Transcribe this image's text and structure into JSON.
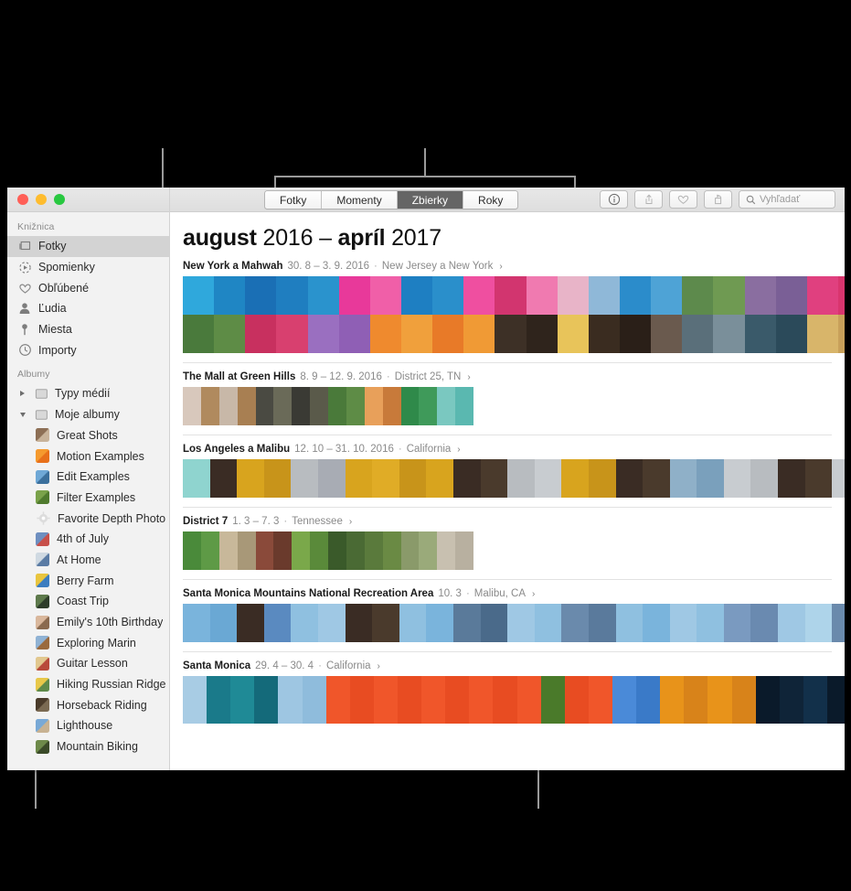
{
  "window": {
    "traffic_lights": [
      "close",
      "minimize",
      "zoom"
    ]
  },
  "sidebar": {
    "library_section": "Knižnica",
    "library_items": [
      {
        "label": "Fotky",
        "icon": "photos-icon",
        "selected": true
      },
      {
        "label": "Spomienky",
        "icon": "memories-icon",
        "selected": false
      },
      {
        "label": "Obľúbené",
        "icon": "heart-icon",
        "selected": false
      },
      {
        "label": "Ľudia",
        "icon": "person-icon",
        "selected": false
      },
      {
        "label": "Miesta",
        "icon": "pin-icon",
        "selected": false
      },
      {
        "label": "Importy",
        "icon": "clock-icon",
        "selected": false
      }
    ],
    "albums_section": "Albumy",
    "groups": [
      {
        "label": "Typy médií",
        "icon": "folder-icon",
        "expanded": false
      },
      {
        "label": "Moje albumy",
        "icon": "folder-icon",
        "expanded": true
      }
    ],
    "albums": [
      {
        "label": "Great Shots",
        "c1": "#8d6f55",
        "c2": "#c8b39a"
      },
      {
        "label": "Motion Examples",
        "c1": "#f59a2e",
        "c2": "#e8701a"
      },
      {
        "label": "Edit Examples",
        "c1": "#6fa8d6",
        "c2": "#3b6f9c"
      },
      {
        "label": "Filter Examples",
        "c1": "#7aa24a",
        "c2": "#4f7a2d"
      },
      {
        "label": "Favorite Depth Photo",
        "c1": "#dcdcdc",
        "c2": "#c4c4c4",
        "icon": "gear-icon"
      },
      {
        "label": "4th of July",
        "c1": "#6e8fc0",
        "c2": "#c7504a"
      },
      {
        "label": "At Home",
        "c1": "#cfd9e2",
        "c2": "#5a7ba4"
      },
      {
        "label": "Berry Farm",
        "c1": "#e9c53e",
        "c2": "#3c7dc0"
      },
      {
        "label": "Coast Trip",
        "c1": "#5e7a4c",
        "c2": "#2e3d2a"
      },
      {
        "label": "Emily's 10th Birthday",
        "c1": "#d9b79c",
        "c2": "#8a6a4f"
      },
      {
        "label": "Exploring Marin",
        "c1": "#8fb2d4",
        "c2": "#9a6a3e"
      },
      {
        "label": "Guitar Lesson",
        "c1": "#e2c88f",
        "c2": "#b84a3a"
      },
      {
        "label": "Hiking Russian Ridge",
        "c1": "#e8c84a",
        "c2": "#5e8a4a"
      },
      {
        "label": "Horseback Riding",
        "c1": "#4a3b2a",
        "c2": "#7a6a52"
      },
      {
        "label": "Lighthouse",
        "c1": "#79a9d6",
        "c2": "#c8b292"
      },
      {
        "label": "Mountain Biking",
        "c1": "#6e8a4a",
        "c2": "#3a4a28"
      }
    ]
  },
  "toolbar": {
    "tabs": [
      {
        "label": "Fotky",
        "selected": false
      },
      {
        "label": "Momenty",
        "selected": false
      },
      {
        "label": "Zbierky",
        "selected": true
      },
      {
        "label": "Roky",
        "selected": false
      }
    ],
    "buttons": [
      {
        "name": "info-icon",
        "glyph": "ⓘ"
      },
      {
        "name": "share-icon",
        "glyph": "⇧"
      },
      {
        "name": "favorite-icon",
        "glyph": "♡"
      },
      {
        "name": "rotate-icon",
        "glyph": "↻"
      }
    ],
    "search_placeholder": "Vyhľadať"
  },
  "content": {
    "title_month_start": "august",
    "title_year_start": "2016",
    "title_dash": "–",
    "title_month_end": "apríl",
    "title_year_end": "2017",
    "collections": [
      {
        "name": "New York a Mahwah",
        "dates": "30. 8 – 3. 9. 2016",
        "separator": "·",
        "place": "New Jersey a New York",
        "chevron": "›",
        "rows": 2,
        "strip_height": 84,
        "photos": [
          "#2fa8dc",
          "#1f86c4",
          "#1a6fb5",
          "#1f7ec0",
          "#2a93cd",
          "#e8399a",
          "#f05fa8",
          "#1e7fc2",
          "#2a8fcb",
          "#ef4fa0",
          "#d2356f",
          "#f07ab0",
          "#e8b4c8",
          "#8fb8d8",
          "#2b8ccb",
          "#4ea3d6",
          "#5d8a4c",
          "#6f9a52",
          "#8a6ea0",
          "#7a5f96",
          "#e0407f",
          "#d9356e",
          "#3a6f52",
          "#2f5f46",
          "#c76a8a",
          "#b85a7a",
          "#4a7a3c",
          "#5e8c46",
          "#c8305f",
          "#d8406f",
          "#9a6fc0",
          "#8f5fb5",
          "#ef8a2e",
          "#f0a03c",
          "#e87a28",
          "#f09a35",
          "#3d3026",
          "#2f241c",
          "#e8c45a",
          "#3a2c20",
          "#2a1f18",
          "#6a5a4e",
          "#5a6f7a",
          "#7a8f9a",
          "#3a5a6a",
          "#2b4a5a",
          "#d8b56a",
          "#c8a05a",
          "#8a3a3a",
          "#aa4a4a",
          "#e8d44a",
          "#4a4a3a"
        ]
      },
      {
        "name": "The Mall at Green Hills",
        "dates": "8. 9 – 12. 9. 2016",
        "separator": "·",
        "place": "District 25, TN",
        "chevron": "›",
        "rows": 1,
        "strip_height": 42,
        "photos": [
          "#d8c8bc",
          "#b08a5e",
          "#c8b8a8",
          "#a87f52",
          "#4a4a42",
          "#6a6a58",
          "#3a3a34",
          "#5a5a4a",
          "#4a7a3a",
          "#5e8c46",
          "#e8a05a",
          "#c87a3a",
          "#2f8a4a",
          "#3f9a5a",
          "#7ac8c0",
          "#5ab8b0"
        ]
      },
      {
        "name": "Los Angeles a Malibu",
        "dates": "12. 10 – 31. 10. 2016",
        "separator": "·",
        "place": "California",
        "chevron": "›",
        "rows": 1,
        "strip_height": 42,
        "photos": [
          "#8fd4cf",
          "#3a2c24",
          "#d8a41e",
          "#c8941a",
          "#b8bcc0",
          "#a8acb4",
          "#d8a41e",
          "#e0ac26",
          "#c8941a",
          "#d8a41e",
          "#3a2c24",
          "#4a3a2c",
          "#b8bcc0",
          "#c8ccd0",
          "#d8a41e",
          "#c8941a",
          "#3a2c24",
          "#4a3a2c",
          "#8fb0c8",
          "#7aa0bc",
          "#c8ccd0",
          "#b8bcc0",
          "#3a2c24",
          "#4a3a2c",
          "#c8ccd0",
          "#e8c49a",
          "#d8a41e",
          "#c8941a",
          "#6a4a8a",
          "#d8485a"
        ]
      },
      {
        "name": "District 7",
        "dates": "1. 3 – 7. 3",
        "separator": "·",
        "place": "Tennessee",
        "chevron": "›",
        "rows": 1,
        "strip_height": 42,
        "photos": [
          "#4a8a3a",
          "#5e9a46",
          "#c8b89a",
          "#a89878",
          "#8a4a3a",
          "#6a3a2c",
          "#7aa84a",
          "#5a8a3a",
          "#3a5a2a",
          "#4a6a34",
          "#5a7a3c",
          "#6a8a44",
          "#8a9a6a",
          "#9aaa7a",
          "#c8c0b0",
          "#b8b0a0"
        ]
      },
      {
        "name": "Santa Monica Mountains National Recreation Area",
        "dates": "10. 3",
        "separator": "·",
        "place": "Malibu, CA",
        "chevron": "›",
        "rows": 1,
        "strip_height": 42,
        "photos": [
          "#7ab4dc",
          "#6aa8d4",
          "#3a2c24",
          "#5a8ac0",
          "#8fc0e0",
          "#9fc8e4",
          "#3a2c24",
          "#4a3a2c",
          "#8fc0e0",
          "#7ab4dc",
          "#5a7a9a",
          "#4a6a8a",
          "#9fc8e4",
          "#8fc0e0",
          "#6a8aac",
          "#5a7a9c",
          "#8fc0e0",
          "#7ab4dc",
          "#9fc8e4",
          "#8fc0e0",
          "#7a9ac0",
          "#6a8ab0",
          "#9fc8e4",
          "#aed4ea",
          "#6a8aac",
          "#5a7a9c",
          "#8fc0e0",
          "#7ab4dc",
          "#9fc8e4",
          "#8fc0e0"
        ]
      },
      {
        "name": "Santa Monica",
        "dates": "29. 4 – 30. 4",
        "separator": "·",
        "place": "California",
        "chevron": "›",
        "rows": 1,
        "strip_height": 52,
        "photos": [
          "#a8cce4",
          "#1a7a8a",
          "#1f8a96",
          "#146a7a",
          "#9ec6e2",
          "#8fbcdc",
          "#f0562a",
          "#e84c22",
          "#f0562a",
          "#e84c22",
          "#f0562a",
          "#e84c22",
          "#f0562a",
          "#e84c22",
          "#f0562a",
          "#4a7a2a",
          "#e84c22",
          "#f0562a",
          "#4a8ad8",
          "#3a7ac8",
          "#e8931a",
          "#d8831a",
          "#e8931a",
          "#d8831a",
          "#0a1a2a",
          "#0f2438",
          "#12304a",
          "#0a1a2a",
          "#1a3a5a",
          "#0f2438",
          "#0a1a2a",
          "#12304a",
          "#a88a6a",
          "#8a7054"
        ]
      }
    ]
  }
}
